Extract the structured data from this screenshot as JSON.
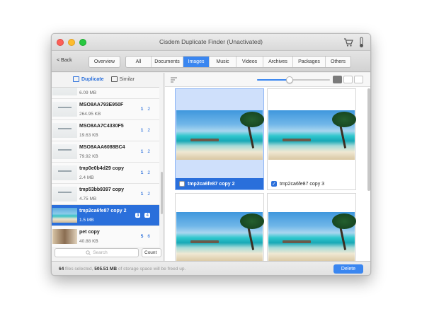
{
  "window": {
    "title": "Cisdem Duplicate Finder (Unactivated)"
  },
  "toolbar": {
    "back_label": "< Back",
    "overview_label": "Overview",
    "tabs": [
      {
        "label": "All"
      },
      {
        "label": "Documents"
      },
      {
        "label": "Images",
        "active": true
      },
      {
        "label": "Music"
      },
      {
        "label": "Videos"
      },
      {
        "label": "Archives"
      },
      {
        "label": "Packages"
      },
      {
        "label": "Others"
      }
    ]
  },
  "sidebar": {
    "segments": {
      "duplicate": "Duplicate",
      "similar": "Similar"
    },
    "items": [
      {
        "name": "",
        "size": "6.09 MB",
        "c1": "",
        "c2": "",
        "thumb": "doc"
      },
      {
        "name": "MSO8AA793E950F",
        "size": "264.95 KB",
        "c1": "1",
        "c2": "2",
        "thumb": "doc"
      },
      {
        "name": "MSO8AA7C4330F5",
        "size": "19.63 KB",
        "c1": "1",
        "c2": "2",
        "thumb": "doc"
      },
      {
        "name": "MSO8AAA6088BC4",
        "size": "79.92 KB",
        "c1": "1",
        "c2": "2",
        "thumb": "doc"
      },
      {
        "name": "tmp0e0b4d29 copy",
        "size": "2.4 MB",
        "c1": "1",
        "c2": "2",
        "thumb": "doc"
      },
      {
        "name": "tmp53bb9397 copy",
        "size": "4.75 MB",
        "c1": "1",
        "c2": "2",
        "thumb": "doc"
      },
      {
        "name": "tmp2ca6fe87 copy 2",
        "size": "1.5 MB",
        "c1": "3",
        "c2": "4",
        "thumb": "beach",
        "selected": true
      },
      {
        "name": "pet copy",
        "size": "40.88 KB",
        "c1": "5",
        "c2": "6",
        "thumb": "pet"
      }
    ],
    "search_placeholder": "Search",
    "count_select": "Count"
  },
  "main": {
    "cards": [
      {
        "caption": "tmp2ca6fe87 copy 2",
        "checked": false,
        "selected": true
      },
      {
        "caption": "tmp2ca6fe87 copy 3",
        "checked": true,
        "selected": false
      },
      {
        "caption": "",
        "checked": false,
        "selected": false
      },
      {
        "caption": "",
        "checked": false,
        "selected": false
      }
    ],
    "zoom_level": 0.45
  },
  "status": {
    "count": "64",
    "files_text": "files selected,",
    "size": "505.51 MB",
    "tail_text": "of storage space will be freed up.",
    "delete_label": "Delete"
  },
  "colors": {
    "accent": "#3a86f0",
    "selection": "#2a6fdb"
  }
}
